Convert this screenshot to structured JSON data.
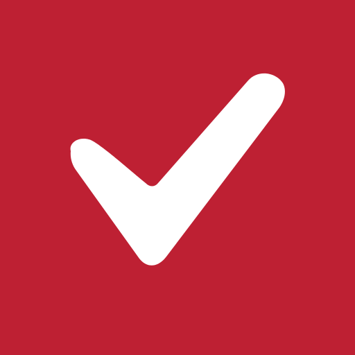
{
  "icon": {
    "name": "checkmark-icon",
    "background_color": "#BE2033",
    "glyph_color": "#FFFFFF"
  }
}
